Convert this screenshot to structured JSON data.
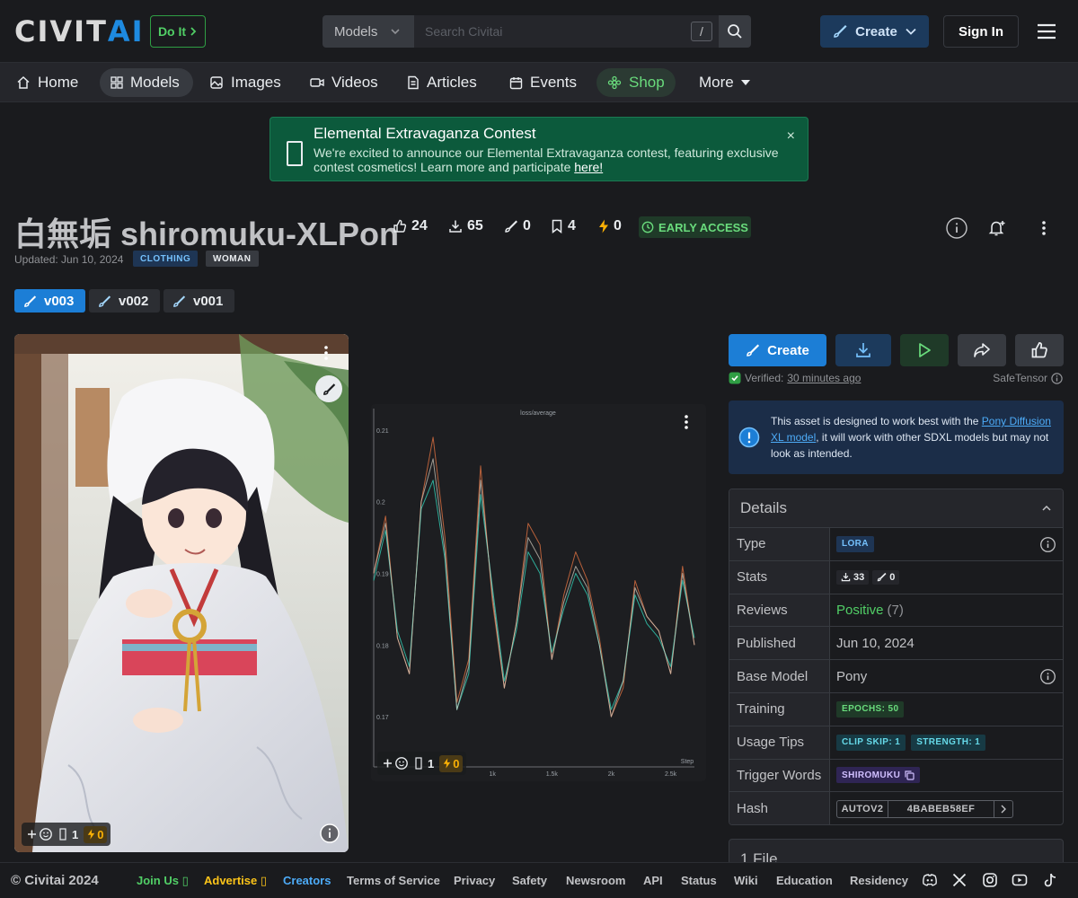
{
  "header": {
    "logo_main": "CIVIT",
    "logo_accent": "AI",
    "doit_label": "Do It",
    "search_category": "Models",
    "search_placeholder": "Search Civitai",
    "search_shortcut": "/",
    "create_label": "Create",
    "signin_label": "Sign In"
  },
  "nav": {
    "items": [
      {
        "label": "Home"
      },
      {
        "label": "Models"
      },
      {
        "label": "Images"
      },
      {
        "label": "Videos"
      },
      {
        "label": "Articles"
      },
      {
        "label": "Events"
      },
      {
        "label": "Shop"
      },
      {
        "label": "More"
      }
    ]
  },
  "banner": {
    "title": "Elemental Extravaganza Contest",
    "text": "We're excited to announce our Elemental Extravaganza contest, featuring exclusive contest cosmetics! Learn more and participate ",
    "link": "here!",
    "close": "×"
  },
  "model": {
    "title": "白無垢 shiromuku-XLPon",
    "stats": {
      "likes": "24",
      "downloads": "65",
      "generations": "0",
      "bookmarks": "4",
      "buzz": "0"
    },
    "early_access": "EARLY ACCESS",
    "updated": "Updated: Jun 10, 2024",
    "tags": [
      "CLOTHING",
      "WOMAN"
    ],
    "versions": [
      "v003",
      "v002",
      "v001"
    ]
  },
  "gallery": {
    "image_card": {
      "comments": "1",
      "buzz": "0"
    },
    "chart_card": {
      "comments": "1",
      "buzz": "0"
    }
  },
  "chart_data": {
    "type": "line",
    "title": "loss/average",
    "xlabel": "Step",
    "x_ticks": [
      "1k",
      "1.5k",
      "2k",
      "2.5k"
    ],
    "y_ticks": [
      "0.21",
      "0.2",
      "0.19",
      "0.18",
      "0.17"
    ],
    "ylim": [
      0.163,
      0.213
    ],
    "xlim": [
      0,
      2700
    ],
    "series": [
      {
        "color": "#c0643c",
        "x": [
          0,
          100,
          200,
          300,
          400,
          500,
          600,
          700,
          800,
          900,
          1000,
          1100,
          1200,
          1300,
          1400,
          1500,
          1600,
          1700,
          1800,
          1900,
          2000,
          2100,
          2200,
          2300,
          2400,
          2500,
          2600,
          2700
        ],
        "values": [
          0.19,
          0.198,
          0.181,
          0.176,
          0.2,
          0.209,
          0.195,
          0.172,
          0.178,
          0.205,
          0.186,
          0.174,
          0.183,
          0.197,
          0.194,
          0.178,
          0.187,
          0.193,
          0.189,
          0.181,
          0.17,
          0.174,
          0.189,
          0.184,
          0.182,
          0.176,
          0.191,
          0.18
        ]
      },
      {
        "color": "#2fb5a0",
        "x": [
          0,
          100,
          200,
          300,
          400,
          500,
          600,
          700,
          800,
          900,
          1000,
          1100,
          1200,
          1300,
          1400,
          1500,
          1600,
          1700,
          1800,
          1900,
          2000,
          2100,
          2200,
          2300,
          2400,
          2500,
          2600,
          2700
        ],
        "values": [
          0.189,
          0.196,
          0.182,
          0.177,
          0.199,
          0.203,
          0.192,
          0.171,
          0.176,
          0.201,
          0.188,
          0.175,
          0.182,
          0.193,
          0.19,
          0.179,
          0.185,
          0.19,
          0.187,
          0.18,
          0.171,
          0.175,
          0.187,
          0.183,
          0.181,
          0.177,
          0.189,
          0.181
        ]
      },
      {
        "color": "#d9d2c5",
        "x": [
          0,
          100,
          200,
          300,
          400,
          500,
          600,
          700,
          800,
          900,
          1000,
          1100,
          1200,
          1300,
          1400,
          1500,
          1600,
          1700,
          1800,
          1900,
          2000,
          2100,
          2200,
          2300,
          2400,
          2500,
          2600,
          2700
        ],
        "values": [
          0.19,
          0.197,
          0.181,
          0.176,
          0.2,
          0.206,
          0.193,
          0.171,
          0.177,
          0.203,
          0.187,
          0.174,
          0.183,
          0.195,
          0.192,
          0.178,
          0.186,
          0.191,
          0.188,
          0.18,
          0.17,
          0.175,
          0.188,
          0.184,
          0.182,
          0.176,
          0.19,
          0.18
        ]
      }
    ]
  },
  "sidebar": {
    "create_label": "Create",
    "verified_label": "Verified:",
    "verified_time": "30 minutes ago",
    "safetensor": "SafeTensor",
    "alert_pre": "This asset is designed to work best with the ",
    "alert_link": "Pony Diffusion XL model",
    "alert_post": ", it will work with other SDXL models but may not look as intended.",
    "details_title": "Details",
    "rows": {
      "type_label": "Type",
      "type_value": "LORA",
      "stats_label": "Stats",
      "stats_downloads": "33",
      "stats_generations": "0",
      "reviews_label": "Reviews",
      "reviews_value": "Positive",
      "reviews_count": "(7)",
      "published_label": "Published",
      "published_value": "Jun 10, 2024",
      "base_label": "Base Model",
      "base_value": "Pony",
      "training_label": "Training",
      "training_value": "EPOCHS: 50",
      "usage_label": "Usage Tips",
      "usage_clip": "CLIP SKIP: 1",
      "usage_strength": "STRENGTH: 1",
      "trigger_label": "Trigger Words",
      "trigger_value": "SHIROMUKU",
      "hash_label": "Hash",
      "hash_type": "AUTOV2",
      "hash_value": "4BABEB58EF"
    },
    "files_title": "1 File"
  },
  "footer": {
    "copyright": "© Civitai 2024",
    "links": [
      "Join Us",
      "Advertise",
      "Creators",
      "Terms of Service",
      "Privacy",
      "Safety",
      "Newsroom",
      "API",
      "Status",
      "Wiki",
      "Education",
      "Residency"
    ]
  },
  "colors": {
    "accent": "#1c7ed6",
    "success": "#51cf66",
    "brand": "#1e8ae0"
  }
}
